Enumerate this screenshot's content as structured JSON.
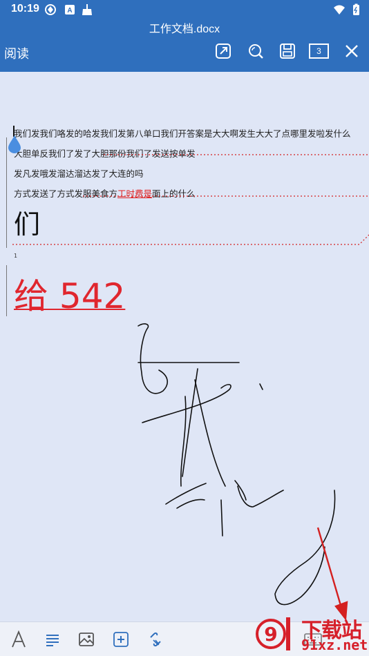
{
  "status_bar": {
    "time": "10:19"
  },
  "header": {
    "doc_title": "工作文档.docx",
    "mode_label": "阅读",
    "tab_count": "3"
  },
  "document": {
    "lines": [
      "我们发我们咯发的哈发我们发第八单口我们开答案是大大啊发生大大了点哪里发啦发什么",
      "大胆单反我们了发了大胆那份我们了发送按单发",
      "发凡发哦发溜达溜达发了大连的吗"
    ],
    "line4_before": "方式发送了方式发服美食方",
    "line4_highlight": "工时费是",
    "line4_after": "面上的什么",
    "big_char": "们",
    "small_num": "1",
    "red_text": "给 542"
  },
  "colors": {
    "header_bg": "#2f6fbd",
    "doc_bg": "#dfe6f6",
    "accent_red": "#e0262e",
    "toolbar_blue": "#2f6fbd"
  },
  "watermark": {
    "line1": "下载站",
    "line2": "91xz.net"
  },
  "icons": {
    "status": [
      "sync-icon",
      "a-box-icon",
      "broom-icon",
      "wifi-icon",
      "battery-icon"
    ],
    "header": [
      "share-export-icon",
      "search-icon",
      "save-icon",
      "close-icon"
    ],
    "bottom": [
      "text-format-icon",
      "paragraph-icon",
      "image-icon",
      "insert-icon",
      "link-icon",
      "keyboard-icon"
    ]
  }
}
